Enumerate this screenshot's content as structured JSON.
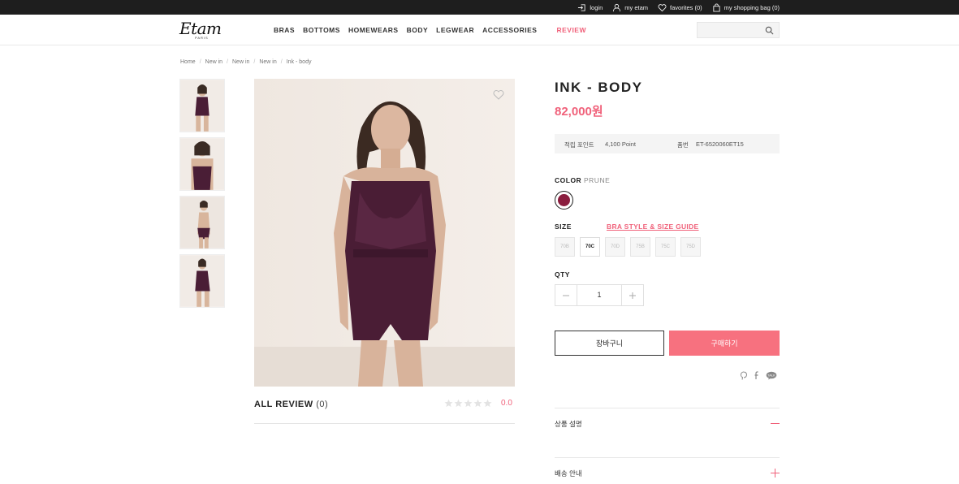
{
  "topbar": {
    "login": "login",
    "my_etam": "my etam",
    "favorites": "favorites (0)",
    "shopping_bag": "my shopping bag (0)"
  },
  "header": {
    "logo_text": "Etam",
    "logo_sub": "PARIS",
    "nav": [
      "BRAS",
      "BOTTOMS",
      "HOMEWEARS",
      "BODY",
      "LEGWEAR",
      "ACCESSORIES"
    ],
    "nav_review": "REVIEW",
    "search_placeholder": ""
  },
  "breadcrumb": [
    "Home",
    "New in",
    "New in",
    "New in",
    "Ink - body"
  ],
  "product": {
    "title": "INK - BODY",
    "price": "82,000원",
    "points_label": "적립 포인트",
    "points_value": "4,100 Point",
    "product_no_label": "품번",
    "product_no_value": "ET-6520060ET15",
    "color_label": "COLOR",
    "color_value": "PRUNE",
    "swatch_color": "#8a1d3e",
    "size_label": "SIZE",
    "size_guide": "BRA STYLE & SIZE GUIDE",
    "sizes": [
      "70B",
      "70C",
      "70D",
      "75B",
      "75C",
      "75D"
    ],
    "selected_size": "70C",
    "qty_label": "QTY",
    "qty_value": "1",
    "cart_button": "장바구니",
    "buy_button": "구매하기"
  },
  "review": {
    "title": "ALL REVIEW",
    "count": "(0)",
    "score": "0.0",
    "stars_filled": 0,
    "stars_total": 5
  },
  "accordion": [
    {
      "title": "상품 설명",
      "state": "open"
    },
    {
      "title": "배송 안내",
      "state": "closed"
    }
  ],
  "colors": {
    "accent": "#f0617a",
    "buy_button": "#f7717f",
    "topbar": "#1e1e1e"
  }
}
